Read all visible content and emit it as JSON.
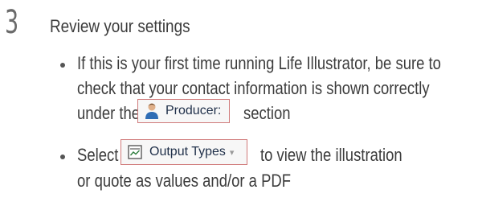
{
  "step": {
    "number": "3",
    "title": "Review your settings"
  },
  "bullets": [
    {
      "line1": "If this is your first time running Life Illustrator, be sure to",
      "line2": "check that your contact information is shown correctly",
      "line3_before": "under the",
      "button_label": "Producer:",
      "button_icon": "person-icon",
      "line3_after": "section"
    },
    {
      "line1_before": "Select",
      "button_label": "Output Types",
      "button_icon": "output-types-icon",
      "button_caret": "▾",
      "line1_after": "to view the illustration",
      "line2": "or quote as values and/or a PDF"
    }
  ],
  "colors": {
    "button_border": "#d07a7a",
    "button_text": "#1f2f49",
    "body_text": "#3c3c3c"
  }
}
